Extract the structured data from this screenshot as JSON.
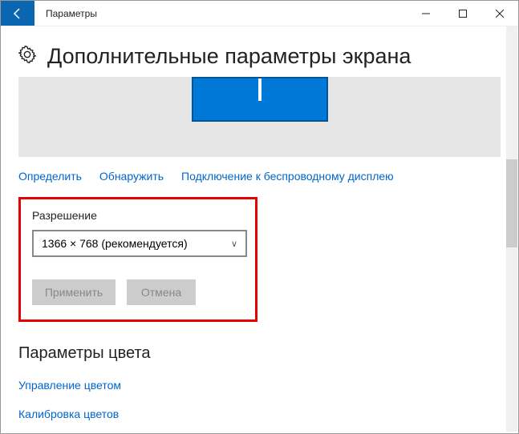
{
  "window": {
    "title": "Параметры"
  },
  "page": {
    "heading": "Дополнительные параметры экрана"
  },
  "display_links": {
    "identify": "Определить",
    "detect": "Обнаружить",
    "wireless": "Подключение к беспроводному дисплею"
  },
  "resolution": {
    "label": "Разрешение",
    "selected": "1366 × 768 (рекомендуется)",
    "apply": "Применить",
    "cancel": "Отмена"
  },
  "color": {
    "heading": "Параметры цвета",
    "manage": "Управление цветом",
    "calibrate": "Калибровка цветов"
  }
}
